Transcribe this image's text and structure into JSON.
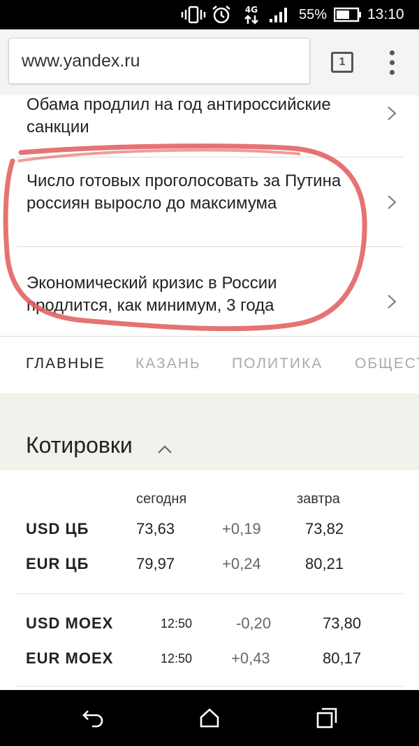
{
  "status_bar": {
    "network": "4G",
    "battery_percent": "55%",
    "time": "13:10",
    "icons": [
      "vibrate-icon",
      "alarm-icon",
      "network-arrows-icon",
      "signal-icon",
      "battery-icon"
    ]
  },
  "browser": {
    "url": "www.yandex.ru",
    "tab_count": "1",
    "menu_icon": "overflow-menu-icon"
  },
  "news": [
    {
      "title": "Обама продлил на год антироссийские санкции"
    },
    {
      "title": "Число готовых проголосовать за Путина россиян выросло до максимума"
    },
    {
      "title": "Экономический кризис в России продлится, как минимум, 3 года"
    }
  ],
  "annotation": {
    "color": "#e05a5a",
    "shape": "hand-drawn circle around news items 2 and 3"
  },
  "categories": [
    "ГЛАВНЫЕ",
    "КАЗАНЬ",
    "ПОЛИТИКА",
    "ОБЩЕСТ"
  ],
  "active_category": "ГЛАВНЫЕ",
  "quotes": {
    "title": "Котировки",
    "col_today": "сегодня",
    "col_tomorrow": "завтра",
    "cb_rows": [
      {
        "name": "USD ЦБ",
        "today": "73,63",
        "change": "+0,19",
        "tomorrow": "73,82"
      },
      {
        "name": "EUR ЦБ",
        "today": "79,97",
        "change": "+0,24",
        "tomorrow": "80,21"
      }
    ],
    "moex_rows": [
      {
        "name": "USD MOEX",
        "time": "12:50",
        "change": "-0,20",
        "value": "73,80"
      },
      {
        "name": "EUR MOEX",
        "time": "12:50",
        "change": "+0,43",
        "value": "80,17"
      }
    ]
  },
  "nav_bar": {
    "icons": [
      "back-icon",
      "home-icon",
      "recents-icon"
    ]
  },
  "colors": {
    "status_bar_bg": "#000000",
    "quotes_header_bg": "#f2f1ec",
    "annotation_red": "#e05a5a",
    "inactive_tab": "#aaaaaa"
  }
}
